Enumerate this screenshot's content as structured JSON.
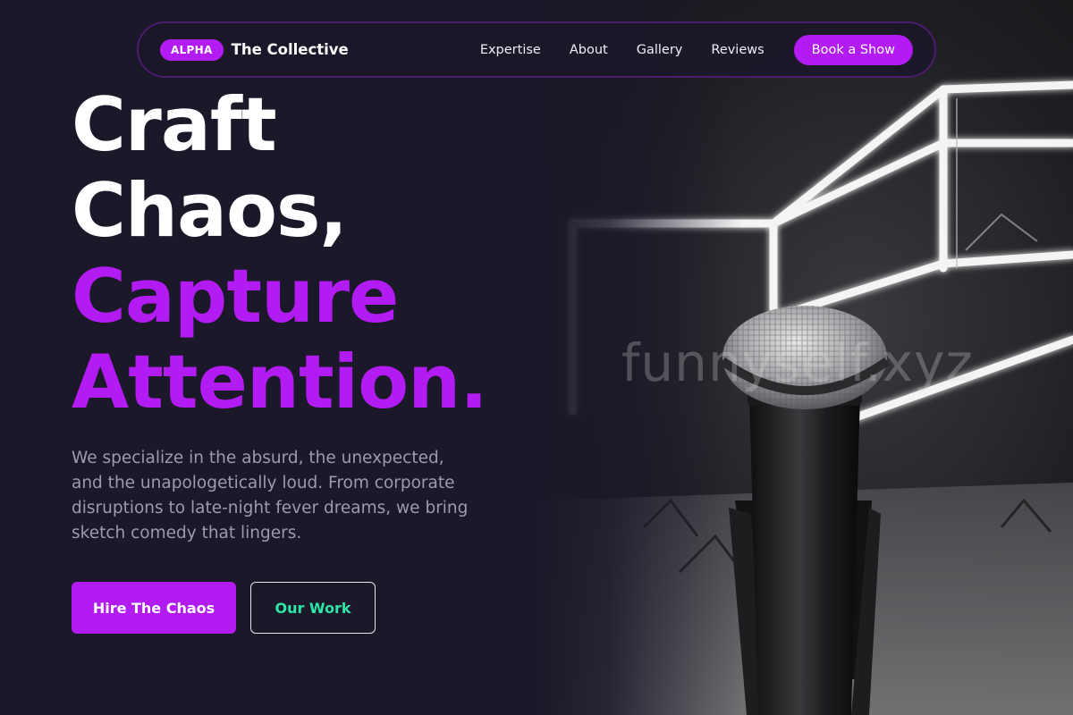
{
  "nav": {
    "badge": "ALPHA",
    "brand": "The Collective",
    "links": [
      "Expertise",
      "About",
      "Gallery",
      "Reviews"
    ],
    "cta": "Book a Show"
  },
  "hero": {
    "headline_line1": "Craft",
    "headline_line2": "Chaos,",
    "headline_line3": "Capture",
    "headline_line4": "Attention.",
    "description": "We specialize in the absurd, the unexpected, and the unapologetically loud. From corporate disruptions to late-night fever dreams, we bring sketch comedy that lingers.",
    "primary_button": "Hire The Chaos",
    "secondary_button": "Our Work",
    "watermark": "funnyself.xyz"
  },
  "colors": {
    "background": "#1b1829",
    "accent": "#b21cf2",
    "secondary_text": "#2ee6a8"
  }
}
